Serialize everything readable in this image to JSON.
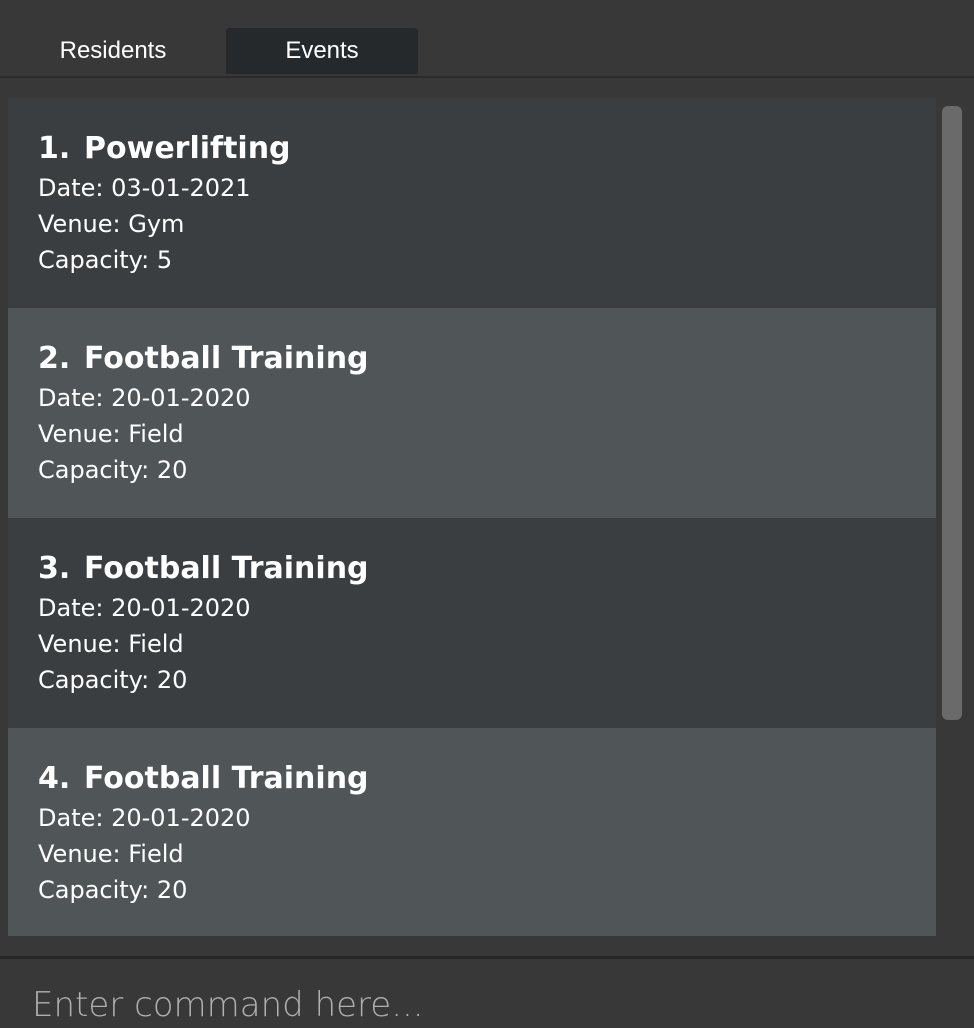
{
  "tabs": [
    {
      "label": "Residents",
      "active": false
    },
    {
      "label": "Events",
      "active": true
    }
  ],
  "events": [
    {
      "index": "1.",
      "name": "Powerlifting",
      "date": "Date: 03-01-2021",
      "venue": "Venue: Gym",
      "capacity": "Capacity: 5"
    },
    {
      "index": "2.",
      "name": "Football Training",
      "date": "Date: 20-01-2020",
      "venue": "Venue: Field",
      "capacity": "Capacity: 20"
    },
    {
      "index": "3.",
      "name": "Football Training",
      "date": "Date: 20-01-2020",
      "venue": "Venue: Field",
      "capacity": "Capacity: 20"
    },
    {
      "index": "4.",
      "name": "Football Training",
      "date": "Date: 20-01-2020",
      "venue": "Venue: Field",
      "capacity": "Capacity: 20"
    }
  ],
  "command": {
    "placeholder": "Enter command here...",
    "value": ""
  },
  "colors": {
    "background": "#383838",
    "active_tab": "#25292c",
    "card_odd": "#3b3e40",
    "card_even": "#505558",
    "scroll_thumb": "#6a6a6a"
  }
}
